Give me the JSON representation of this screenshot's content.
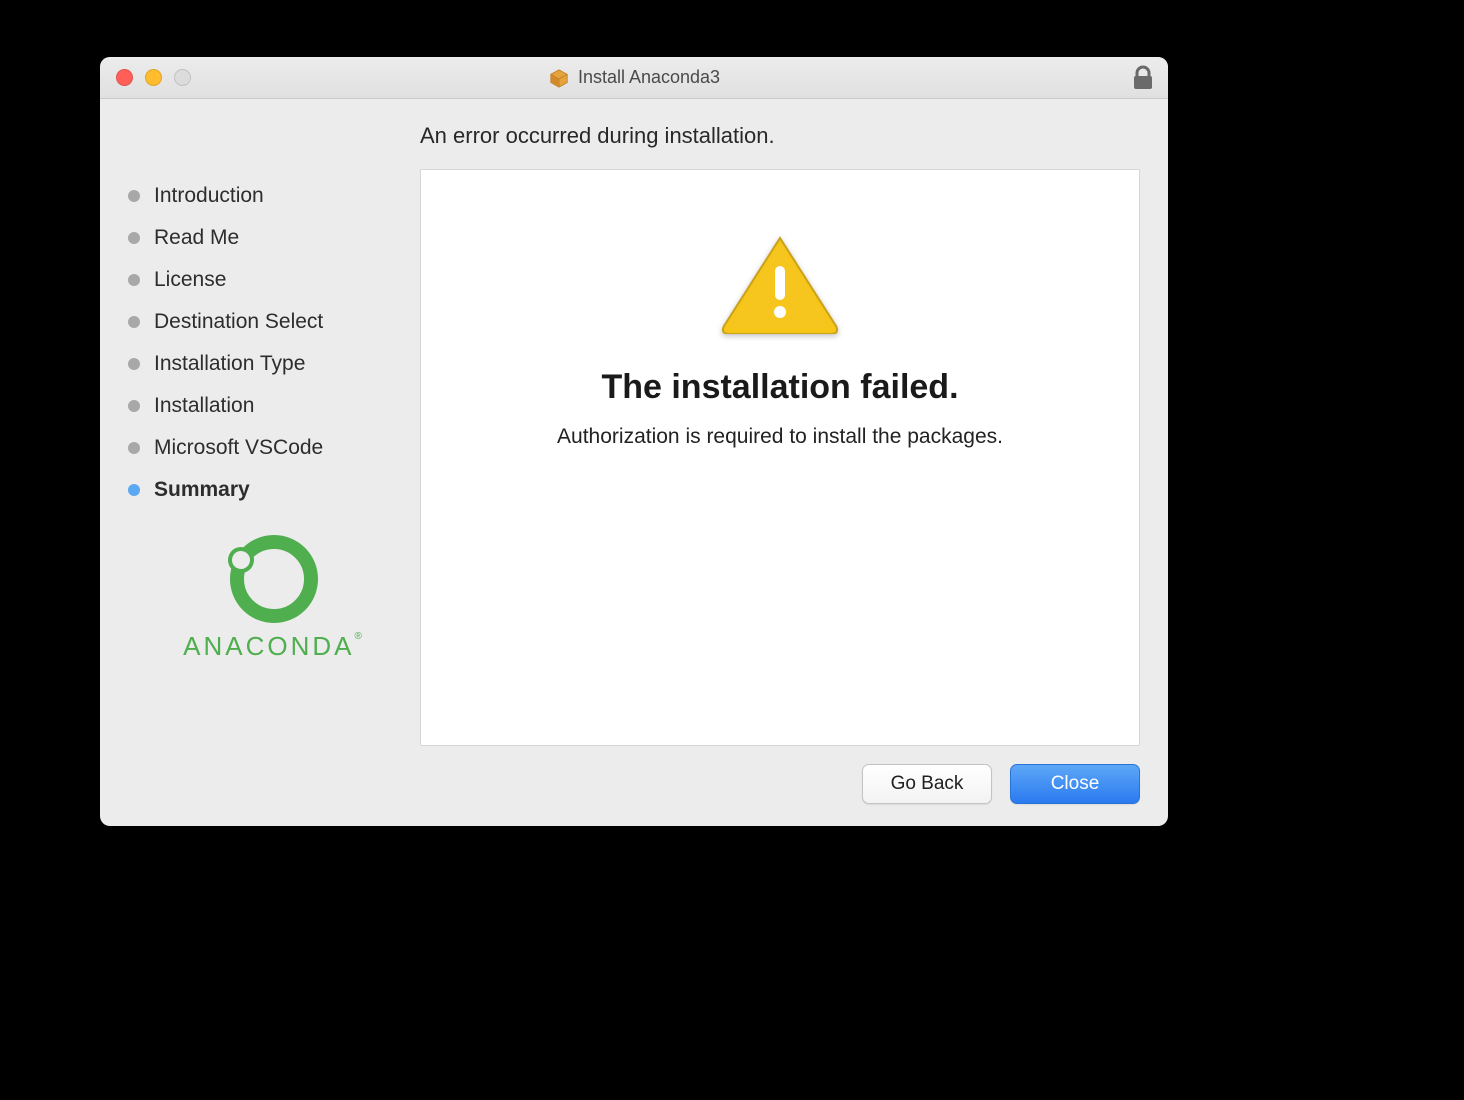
{
  "window": {
    "title": "Install Anaconda3",
    "heading": "An error occurred during installation."
  },
  "sidebar": {
    "steps": [
      {
        "label": "Introduction",
        "active": false
      },
      {
        "label": "Read Me",
        "active": false
      },
      {
        "label": "License",
        "active": false
      },
      {
        "label": "Destination Select",
        "active": false
      },
      {
        "label": "Installation Type",
        "active": false
      },
      {
        "label": "Installation",
        "active": false
      },
      {
        "label": "Microsoft VSCode",
        "active": false
      },
      {
        "label": "Summary",
        "active": true
      }
    ],
    "brand": "ANACONDA"
  },
  "panel": {
    "title": "The installation failed.",
    "message": "Authorization is required to install the packages."
  },
  "footer": {
    "back": "Go Back",
    "close": "Close"
  }
}
